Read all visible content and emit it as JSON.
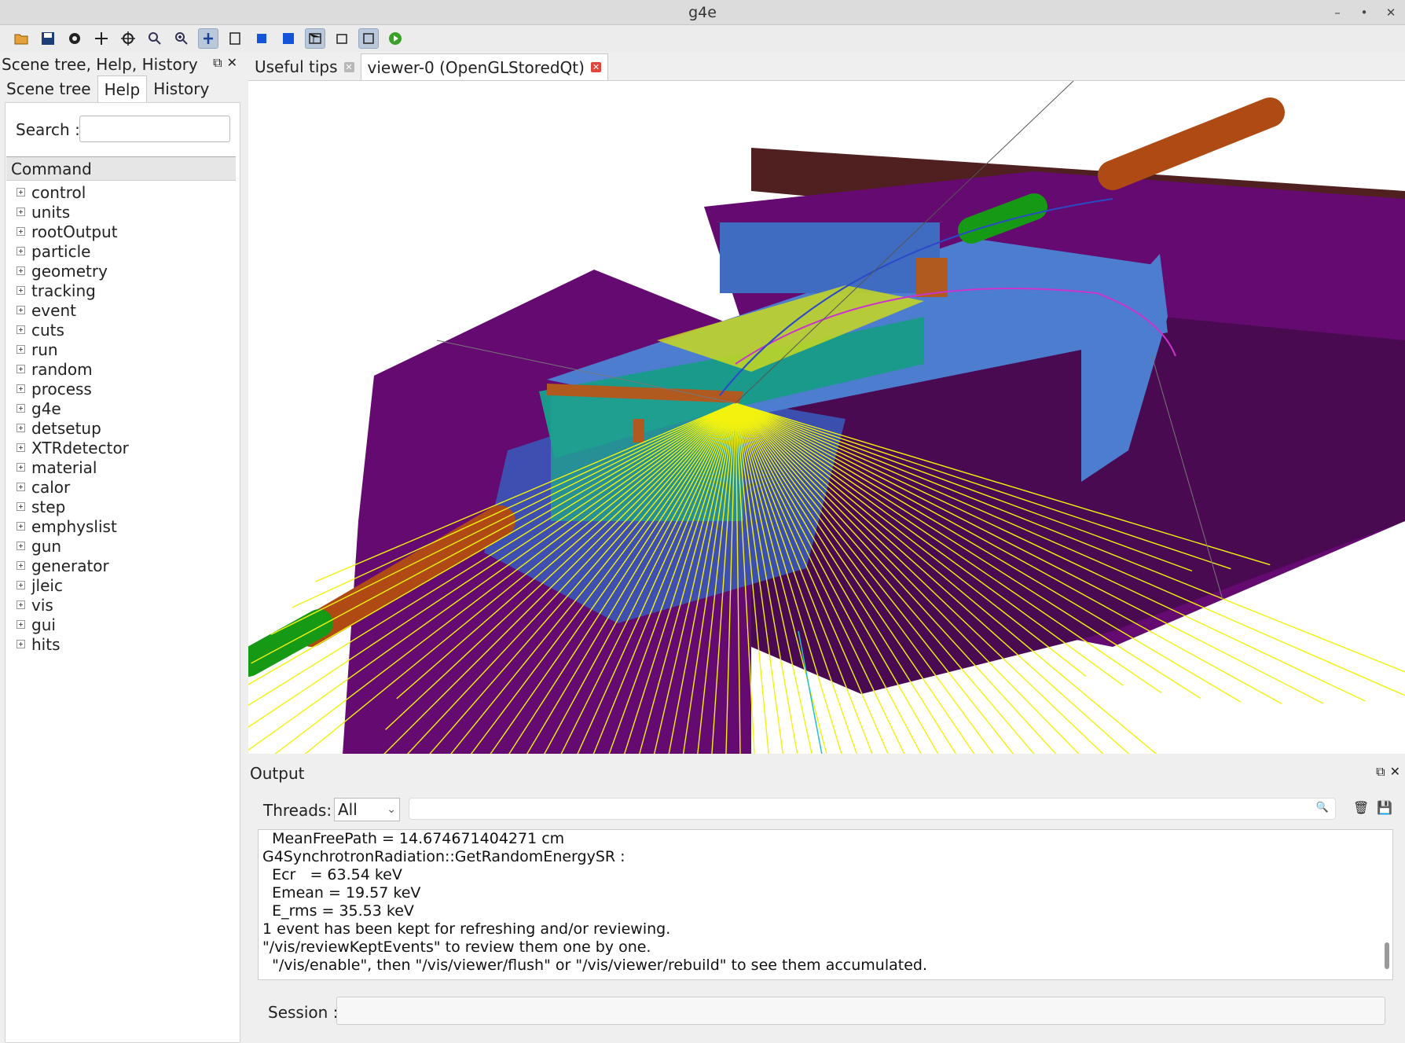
{
  "window": {
    "title": "g4e",
    "controls": [
      "–",
      "•",
      "✕"
    ]
  },
  "toolbar": {
    "icons": [
      "open-folder-icon",
      "save-icon",
      "settings-icon",
      "move-icon",
      "target-icon",
      "zoom-out-icon",
      "zoom-in-icon",
      "rotate-icon",
      "perspective-icon",
      "solid-icon",
      "solid-blue-icon",
      "wireframe-icon",
      "hidden-line-icon",
      "hidden-surface-icon",
      "run-icon"
    ]
  },
  "left_dock": {
    "title": "Scene tree, Help, History",
    "tabs": [
      "Scene tree",
      "Help",
      "History"
    ],
    "selected_tab": "Help",
    "search_label": "Search :",
    "search_value": "",
    "command_header": "Command",
    "commands": [
      "control",
      "units",
      "rootOutput",
      "particle",
      "geometry",
      "tracking",
      "event",
      "cuts",
      "run",
      "random",
      "process",
      "g4e",
      "detsetup",
      "XTRdetector",
      "material",
      "calor",
      "step",
      "emphyslist",
      "gun",
      "generator",
      "jleic",
      "vis",
      "gui",
      "hits"
    ]
  },
  "viewer_tabs": [
    {
      "label": "Useful tips"
    },
    {
      "label": "viewer-0 (OpenGLStoredQt)"
    }
  ],
  "output": {
    "title": "Output",
    "threads_label": "Threads:",
    "threads_value": "All",
    "filter_value": "",
    "lines": [
      "  MeanFreePath = 14.674671404271 cm",
      "G4SynchrotronRadiation::GetRandomEnergySR :",
      "  Ecr   = 63.54 keV",
      "  Emean = 19.57 keV",
      "  E_rms = 35.53 keV",
      "1 event has been kept for refreshing and/or reviewing.",
      "\"/vis/reviewKeptEvents\" to review them one by one.",
      "  \"/vis/enable\", then \"/vis/viewer/flush\" or \"/vis/viewer/rebuild\" to see them accumulated."
    ],
    "session_label": "Session :",
    "session_value": ""
  },
  "colors": {
    "magenta_detector": "#650a70",
    "blue_volume": "#4b79c9",
    "track_yellow": "#f2f20f",
    "pipe_orange": "#b04a14",
    "pipe_green": "#169a16"
  }
}
